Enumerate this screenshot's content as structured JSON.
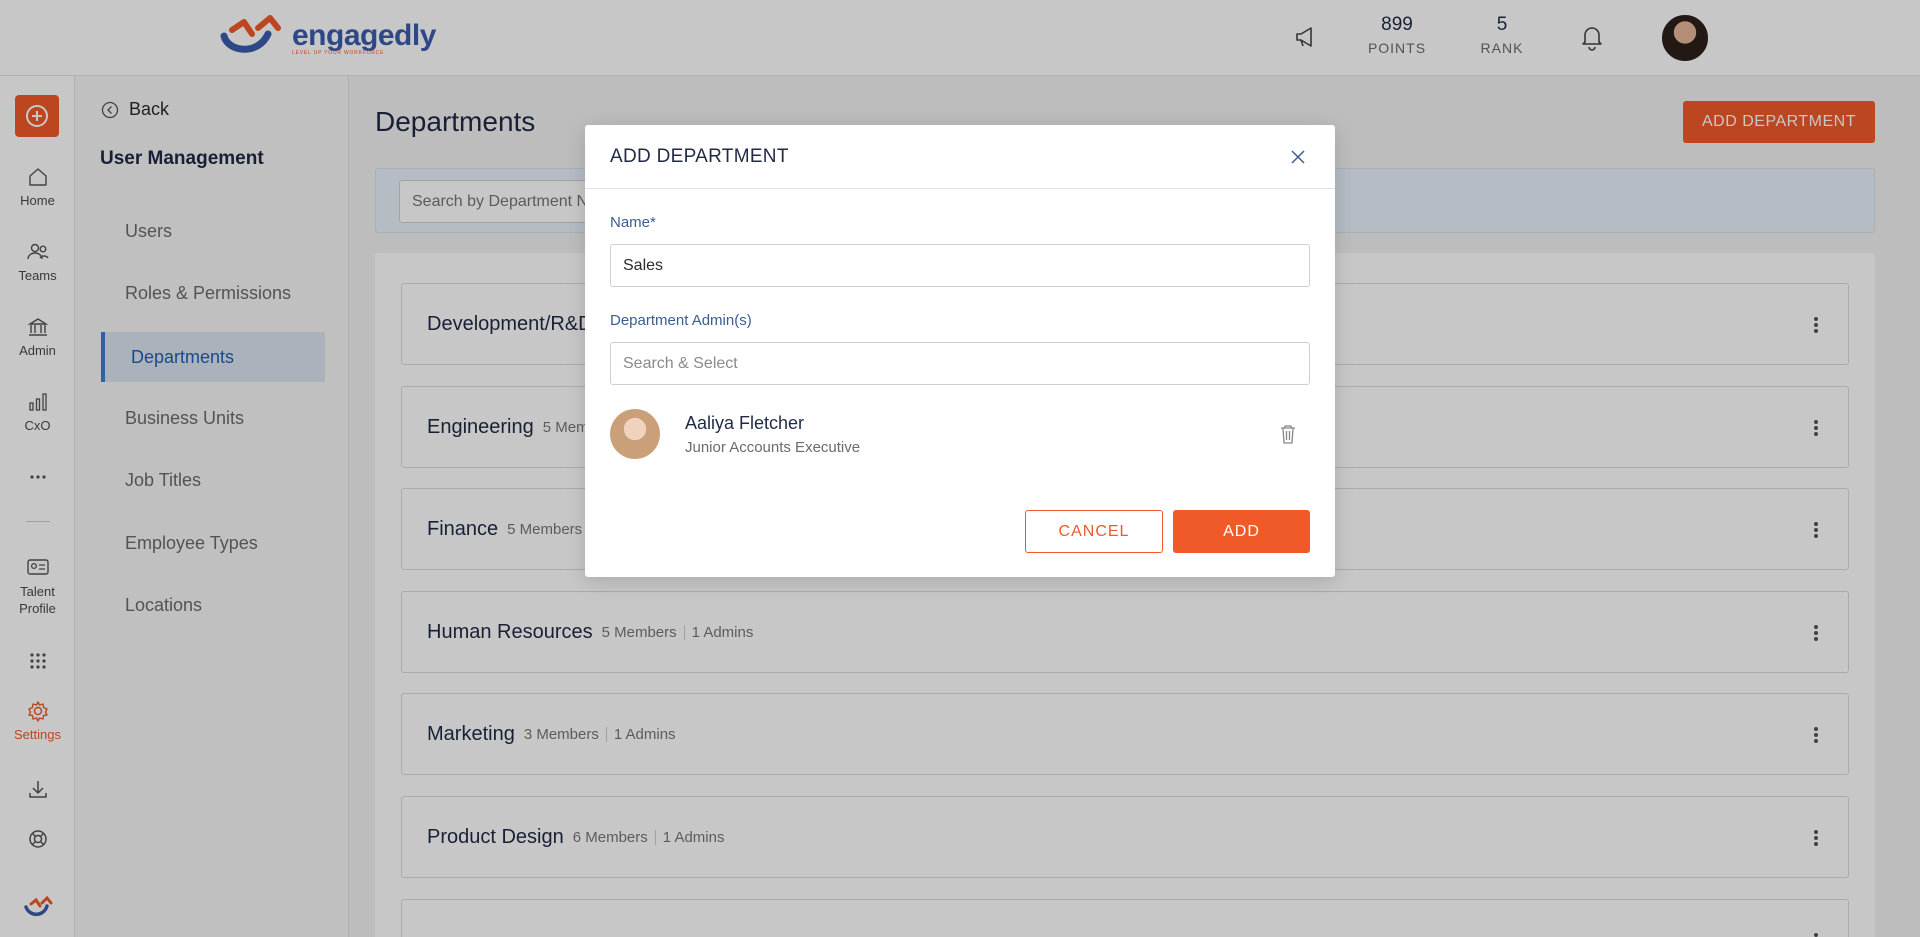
{
  "brand": {
    "name": "engagedly",
    "tagline": "LEVEL UP YOUR WORKFORCE",
    "accent": "#f05a28",
    "primary": "#3b5cad"
  },
  "header": {
    "points_value": "899",
    "points_label": "POINTS",
    "rank_value": "5",
    "rank_label": "RANK"
  },
  "rail": {
    "items": [
      {
        "label": "Home",
        "icon": "home-icon"
      },
      {
        "label": "Teams",
        "icon": "teams-icon"
      },
      {
        "label": "Admin",
        "icon": "admin-icon"
      },
      {
        "label": "CxO",
        "icon": "cxo-icon"
      },
      {
        "label": "Talent\nProfile",
        "icon": "talent-profile-icon"
      },
      {
        "label": "Settings",
        "icon": "settings-icon"
      }
    ]
  },
  "sidebar": {
    "back_label": "Back",
    "title": "User Management",
    "items": [
      {
        "label": "Users"
      },
      {
        "label": "Roles & Permissions"
      },
      {
        "label": "Departments"
      },
      {
        "label": "Business Units"
      },
      {
        "label": "Job Titles"
      },
      {
        "label": "Employee Types"
      },
      {
        "label": "Locations"
      }
    ]
  },
  "main": {
    "title": "Departments",
    "add_button": "ADD DEPARTMENT",
    "search_placeholder": "Search by Department Name",
    "departments": [
      {
        "name": "Development/R&D",
        "members": "",
        "admins": ""
      },
      {
        "name": "Engineering",
        "members": "5 Members",
        "admins": ""
      },
      {
        "name": "Finance",
        "members": "5 Members",
        "admins": ""
      },
      {
        "name": "Human Resources",
        "members": "5 Members",
        "admins": "1 Admins"
      },
      {
        "name": "Marketing",
        "members": "3 Members",
        "admins": "1 Admins"
      },
      {
        "name": "Product Design",
        "members": "6 Members",
        "admins": "1 Admins"
      }
    ]
  },
  "modal": {
    "title": "ADD DEPARTMENT",
    "name_label": "Name*",
    "name_value": "Sales",
    "admins_label": "Department Admin(s)",
    "admins_placeholder": "Search & Select",
    "selected_admin": {
      "name": "Aaliya Fletcher",
      "role": "Junior Accounts Executive"
    },
    "cancel_label": "CANCEL",
    "add_label": "ADD"
  }
}
